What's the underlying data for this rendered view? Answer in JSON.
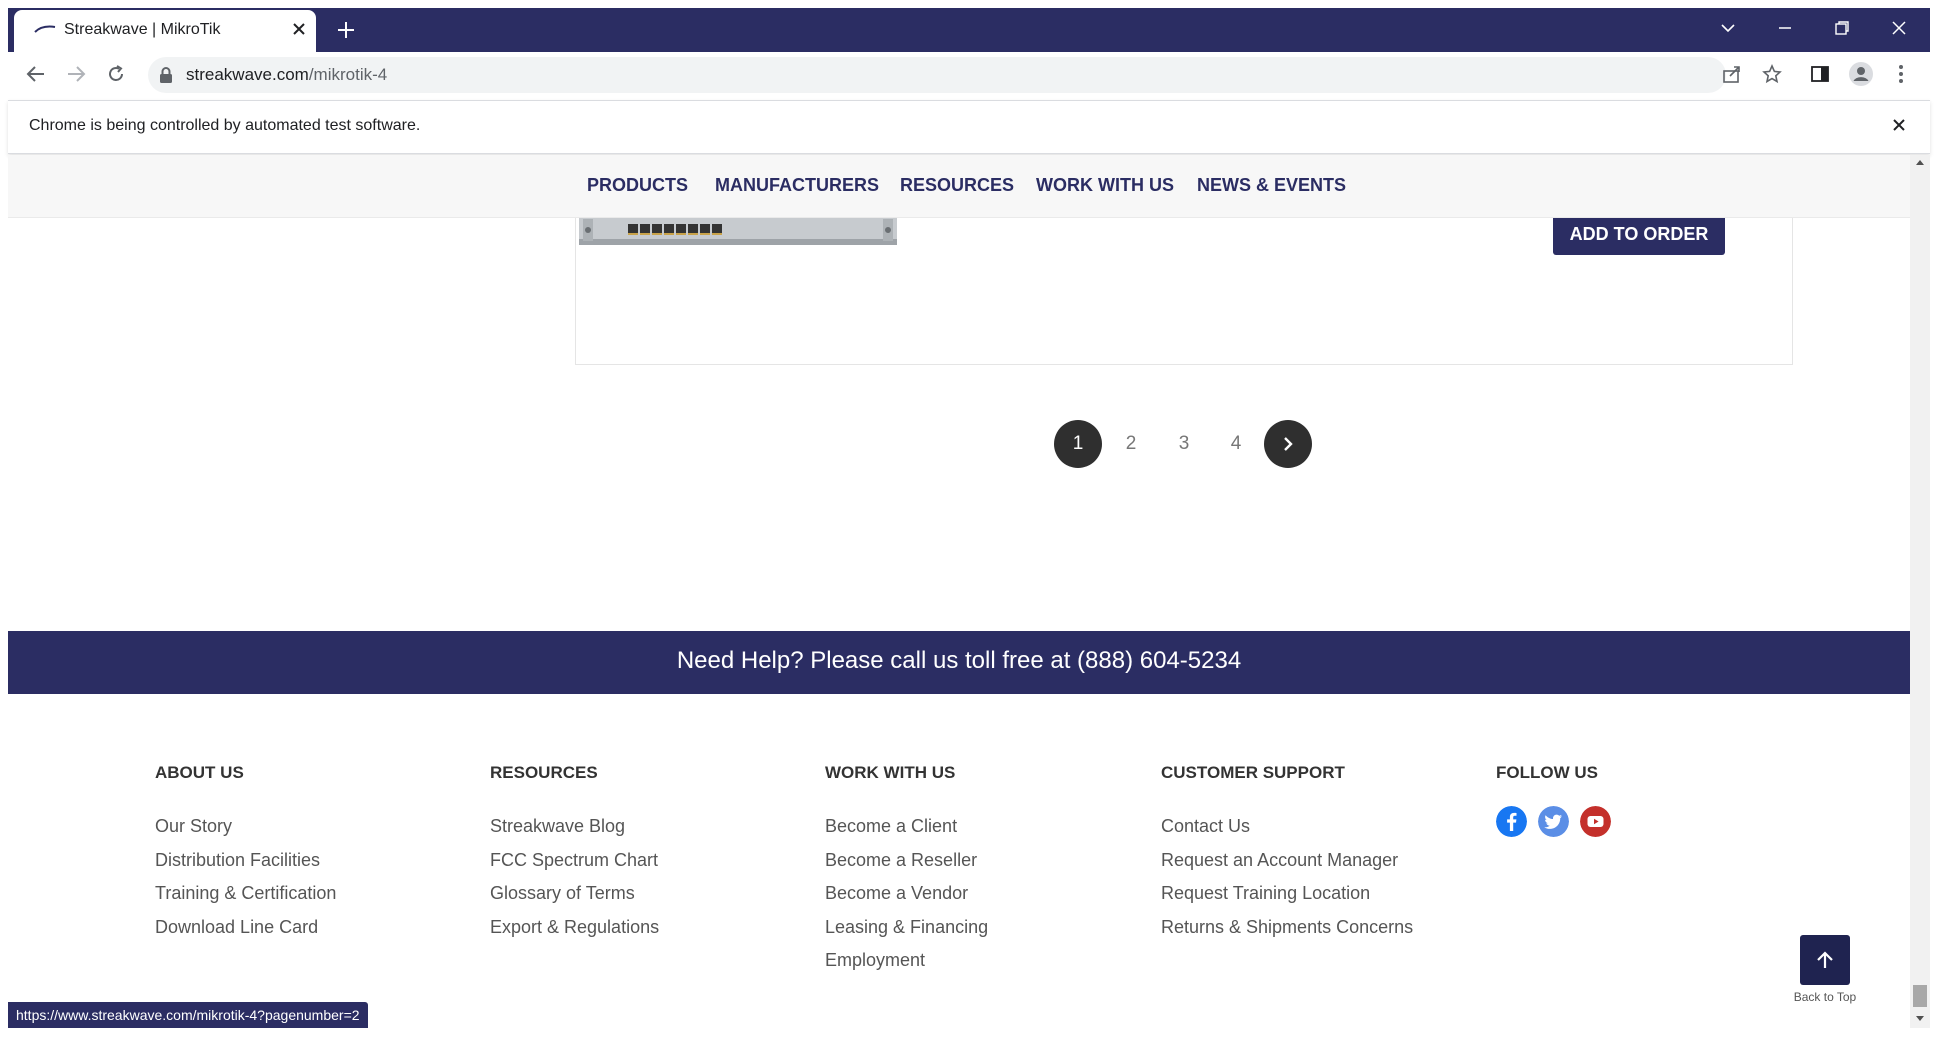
{
  "browser": {
    "tab_title": "Streakwave | MikroTik",
    "url_host": "streakwave.com",
    "url_path": "/mikrotik-4",
    "infobar_text": "Chrome is being controlled by automated test software.",
    "status_url": "https://www.streakwave.com/mikrotik-4?pagenumber=2"
  },
  "nav": {
    "items": [
      "PRODUCTS",
      "MANUFACTURERS",
      "RESOURCES",
      "WORK WITH US",
      "NEWS & EVENTS"
    ]
  },
  "product": {
    "add_label": "ADD TO ORDER"
  },
  "pagination": {
    "pages": [
      "1",
      "2",
      "3",
      "4"
    ],
    "current": "1"
  },
  "help": {
    "text": "Need Help? Please call us toll free at (888) 604-5234"
  },
  "footer": {
    "about": {
      "heading": "ABOUT US",
      "links": [
        "Our Story",
        "Distribution Facilities",
        "Training & Certification",
        "Download Line Card"
      ]
    },
    "resources": {
      "heading": "RESOURCES",
      "links": [
        "Streakwave Blog",
        "FCC Spectrum Chart",
        "Glossary of Terms",
        "Export & Regulations"
      ]
    },
    "work": {
      "heading": "WORK WITH US",
      "links": [
        "Become a Client",
        "Become a Reseller",
        "Become a Vendor",
        "Leasing & Financing",
        "Employment"
      ]
    },
    "support": {
      "heading": "CUSTOMER SUPPORT",
      "links": [
        "Contact Us",
        "Request an Account Manager",
        "Request Training Location",
        "Returns & Shipments Concerns"
      ]
    },
    "follow": {
      "heading": "FOLLOW US",
      "icons": [
        "facebook-icon",
        "twitter-icon",
        "youtube-icon"
      ]
    }
  },
  "back_to_top": "Back to Top",
  "colors": {
    "brand_navy": "#2b2d63",
    "pagination_dark": "#2f2f2f",
    "facebook": "#1877f2",
    "twitter": "#5b8ee6",
    "youtube": "#c4302b"
  }
}
